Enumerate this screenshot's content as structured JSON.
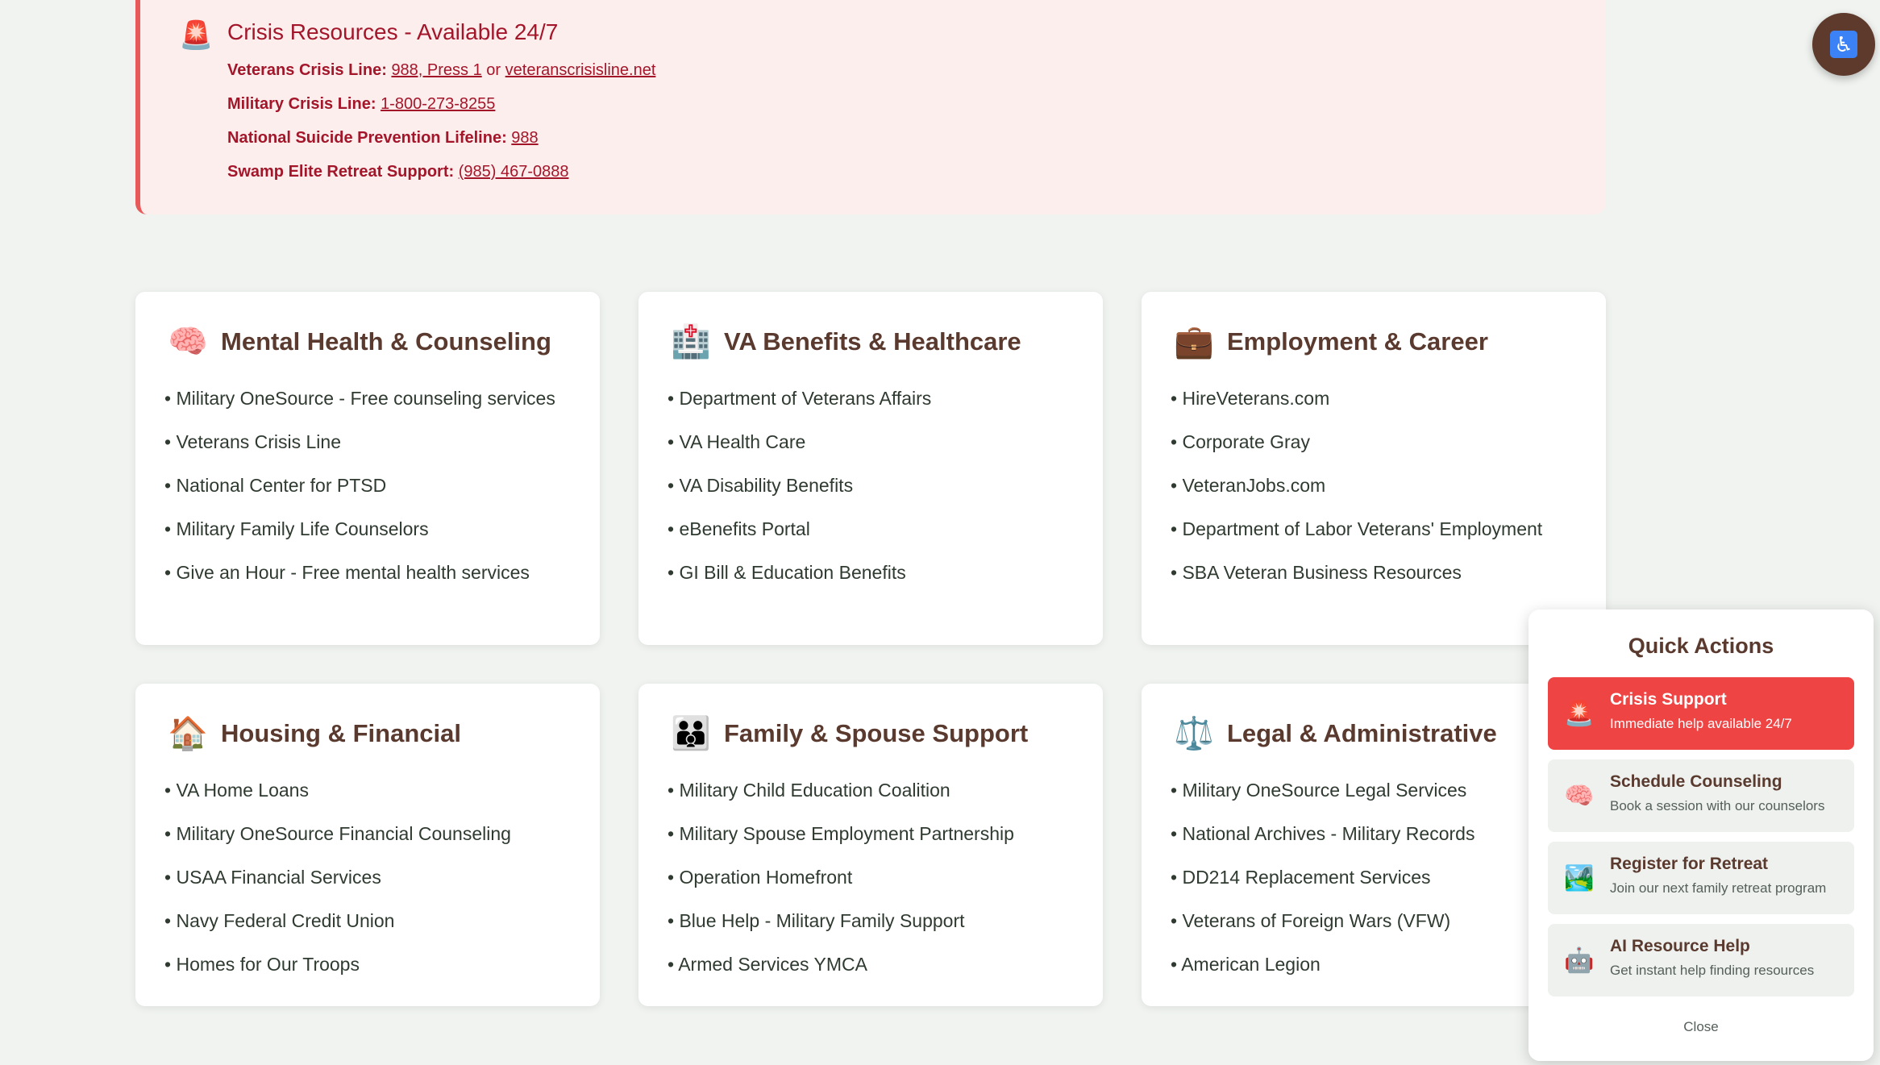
{
  "crisis": {
    "title": "Crisis Resources - Available 24/7",
    "icon": "siren-icon",
    "lines": [
      {
        "label": "Veterans Crisis Line:",
        "link1": "988, Press 1",
        "sep": "or",
        "link2": "veteranscrisisline.net"
      },
      {
        "label": "Military Crisis Line:",
        "link1": "1-800-273-8255"
      },
      {
        "label": "National Suicide Prevention Lifeline:",
        "link1": "988"
      },
      {
        "label": "Swamp Elite Retreat Support:",
        "link1": "(985) 467-0888"
      }
    ]
  },
  "cards": [
    {
      "title": "Mental Health & Counseling",
      "icon": "🧠",
      "items": [
        "Military OneSource - Free counseling services",
        "Veterans Crisis Line",
        "National Center for PTSD",
        "Military Family Life Counselors",
        "Give an Hour - Free mental health services"
      ]
    },
    {
      "title": "VA Benefits & Healthcare",
      "icon": "🏥",
      "items": [
        "Department of Veterans Affairs",
        "VA Health Care",
        "VA Disability Benefits",
        "eBenefits Portal",
        "GI Bill & Education Benefits"
      ]
    },
    {
      "title": "Employment & Career",
      "icon": "💼",
      "items": [
        "HireVeterans.com",
        "Corporate Gray",
        "VeteranJobs.com",
        "Department of Labor Veterans' Employment",
        "SBA Veteran Business Resources"
      ]
    },
    {
      "title": "Housing & Financial",
      "icon": "🏠",
      "items": [
        "VA Home Loans",
        "Military OneSource Financial Counseling",
        "USAA Financial Services",
        "Navy Federal Credit Union",
        "Homes for Our Troops"
      ]
    },
    {
      "title": "Family & Spouse Support",
      "icon": "👪",
      "items": [
        "Military Child Education Coalition",
        "Military Spouse Employment Partnership",
        "Operation Homefront",
        "Blue Help - Military Family Support",
        "Armed Services YMCA"
      ]
    },
    {
      "title": "Legal & Administrative",
      "icon": "⚖️",
      "items": [
        "Military OneSource Legal Services",
        "National Archives - Military Records",
        "DD214 Replacement Services",
        "Veterans of Foreign Wars (VFW)",
        "American Legion"
      ]
    }
  ],
  "accessibility": {
    "icon": "♿"
  },
  "quick_actions": {
    "title": "Quick Actions",
    "actions": [
      {
        "title": "Crisis Support",
        "subtitle": "Immediate help available 24/7",
        "icon": "🚨"
      },
      {
        "title": "Schedule Counseling",
        "subtitle": "Book a session with our counselors",
        "icon": "🧠"
      },
      {
        "title": "Register for Retreat",
        "subtitle": "Join our next family retreat program",
        "icon": "🏞️"
      },
      {
        "title": "AI Resource Help",
        "subtitle": "Get instant help finding resources",
        "icon": "🤖"
      }
    ],
    "close_label": "Close"
  },
  "colors": {
    "accent": "#5a3a2e",
    "crisis": "#a3162a",
    "danger": "#ef4444",
    "background": "#f0f3f0"
  }
}
